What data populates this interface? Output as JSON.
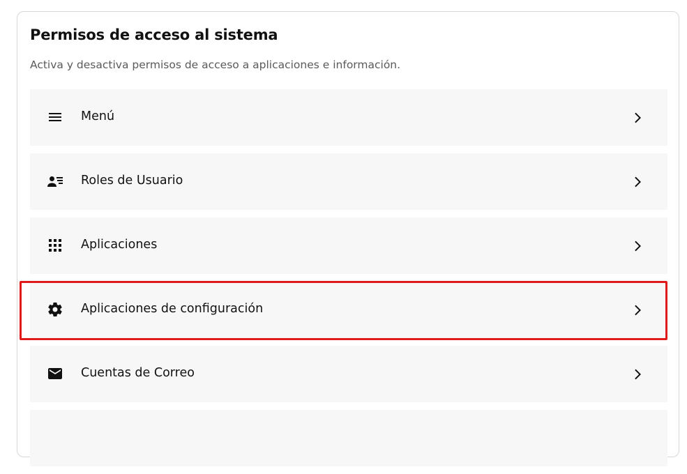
{
  "panel": {
    "title": "Permisos de acceso al sistema",
    "subtitle": "Activa y desactiva permisos de acceso a aplicaciones e información."
  },
  "items": [
    {
      "label": "Menú",
      "icon": "menu-icon"
    },
    {
      "label": "Roles de Usuario",
      "icon": "user-roles-icon"
    },
    {
      "label": "Aplicaciones",
      "icon": "apps-grid-icon"
    },
    {
      "label": "Aplicaciones de configuración",
      "icon": "gear-icon",
      "highlighted": true
    },
    {
      "label": "Cuentas de Correo",
      "icon": "mail-icon"
    },
    {
      "label": "",
      "icon": ""
    }
  ],
  "colors": {
    "row_background": "#f6f7f6",
    "highlight_border": "#e01a1a",
    "title_text": "#111111",
    "subtitle_text": "#5a5a5a"
  }
}
